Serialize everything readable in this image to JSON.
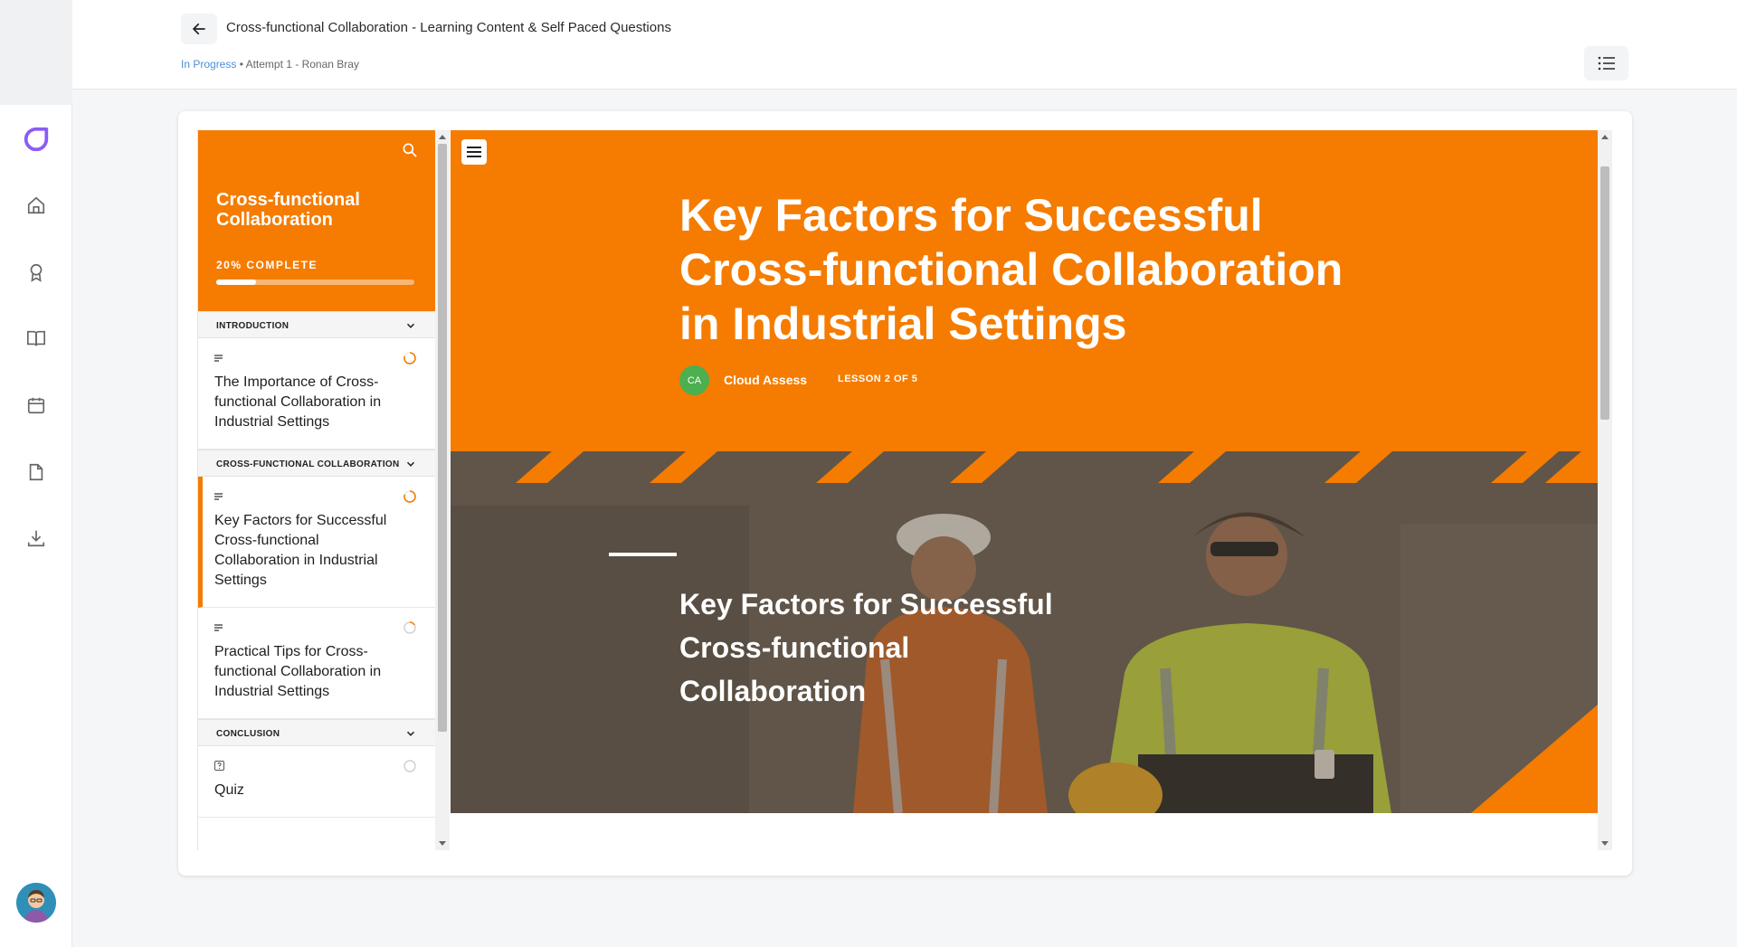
{
  "header": {
    "title": "Cross-functional Collaboration - Learning Content & Self Paced Questions",
    "status": "In Progress",
    "attempt": " • Attempt 1 - Ronan Bray"
  },
  "nav": {
    "icons": [
      "logo-icon",
      "home-icon",
      "award-icon",
      "book-icon",
      "calendar-icon",
      "document-icon",
      "download-icon"
    ]
  },
  "course": {
    "title": "Cross-functional Collaboration",
    "progress_label": "20% COMPLETE",
    "progress": 0.2,
    "sections": [
      {
        "label": "INTRODUCTION",
        "lessons": [
          {
            "label": "The Importance of Cross-functional Collaboration in Industrial Settings",
            "status": "in-progress"
          }
        ]
      },
      {
        "label": "CROSS-FUNCTIONAL COLLABORATION",
        "lessons": [
          {
            "label": "Key Factors for Successful Cross-functional Collaboration in Industrial Settings",
            "status": "in-progress",
            "active": true
          },
          {
            "label": "Practical Tips for Cross-functional Collaboration in Industrial Settings",
            "status": "started"
          }
        ]
      },
      {
        "label": "CONCLUSION",
        "lessons": [
          {
            "label": "Quiz",
            "status": "not-started"
          }
        ]
      }
    ]
  },
  "lesson": {
    "title": "Key Factors for Successful Cross-functional Collaboration in Industrial Settings",
    "author_initials": "CA",
    "author": "Cloud Assess",
    "lesson_count": "LESSON 2 OF 5",
    "banner_title": "Key Factors for Successful Cross-functional Collaboration"
  },
  "colors": {
    "accent": "#f57c00",
    "link": "#4a90d9"
  }
}
